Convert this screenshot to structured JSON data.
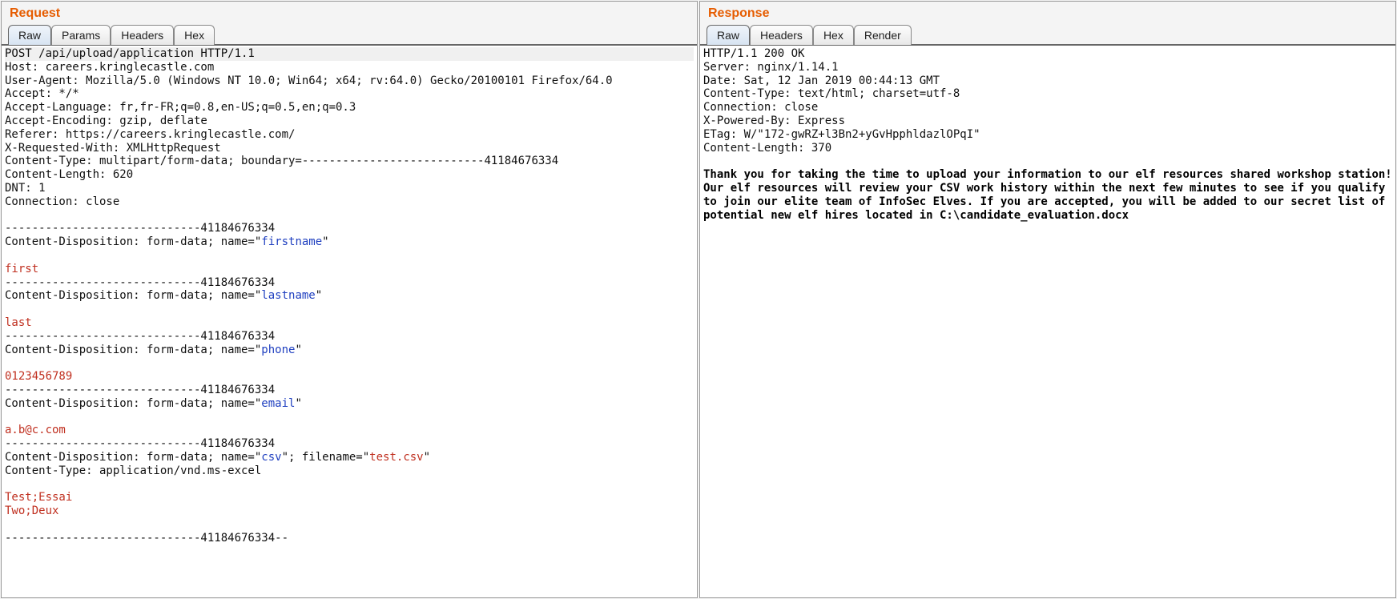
{
  "request": {
    "title": "Request",
    "tabs": [
      "Raw",
      "Params",
      "Headers",
      "Hex"
    ],
    "active_tab": 0,
    "first_line": "POST /api/upload/application HTTP/1.1",
    "headers": [
      "Host: careers.kringlecastle.com",
      "User-Agent: Mozilla/5.0 (Windows NT 10.0; Win64; x64; rv:64.0) Gecko/20100101 Firefox/64.0",
      "Accept: */*",
      "Accept-Language: fr,fr-FR;q=0.8,en-US;q=0.5,en;q=0.3",
      "Accept-Encoding: gzip, deflate",
      "Referer: https://careers.kringlecastle.com/",
      "X-Requested-With: XMLHttpRequest",
      "Content-Type: multipart/form-data; boundary=---------------------------41184676334",
      "Content-Length: 620",
      "DNT: 1",
      "Connection: close"
    ],
    "parts": [
      {
        "boundary": "-----------------------------41184676334",
        "disp_prefix": "Content-Disposition: form-data; name=\"",
        "name": "firstname",
        "disp_suffix": "\"",
        "value": "first"
      },
      {
        "boundary": "-----------------------------41184676334",
        "disp_prefix": "Content-Disposition: form-data; name=\"",
        "name": "lastname",
        "disp_suffix": "\"",
        "value": "last"
      },
      {
        "boundary": "-----------------------------41184676334",
        "disp_prefix": "Content-Disposition: form-data; name=\"",
        "name": "phone",
        "disp_suffix": "\"",
        "value": "0123456789"
      },
      {
        "boundary": "-----------------------------41184676334",
        "disp_prefix": "Content-Disposition: form-data; name=\"",
        "name": "email",
        "disp_suffix": "\"",
        "value": "a.b@c.com"
      }
    ],
    "file_part": {
      "boundary": "-----------------------------41184676334",
      "disp_prefix": "Content-Disposition: form-data; name=\"",
      "name": "csv",
      "mid": "\"; filename=\"",
      "filename": "test.csv",
      "suffix": "\"",
      "ctype": "Content-Type: application/vnd.ms-excel",
      "body1": "Test;Essai",
      "body2": "Two;Deux"
    },
    "closing_boundary": "-----------------------------41184676334--"
  },
  "response": {
    "title": "Response",
    "tabs": [
      "Raw",
      "Headers",
      "Hex",
      "Render"
    ],
    "active_tab": 0,
    "first_line": "HTTP/1.1 200 OK",
    "headers": [
      "Server: nginx/1.14.1",
      "Date: Sat, 12 Jan 2019 00:44:13 GMT",
      "Content-Type: text/html; charset=utf-8",
      "Connection: close",
      "X-Powered-By: Express",
      "ETag: W/\"172-gwRZ+l3Bn2+yGvHpphldazlOPqI\"",
      "Content-Length: 370"
    ],
    "body": "Thank you for taking the time to upload your information to our elf resources shared workshop station! Our elf resources will review your CSV work history within the next few minutes to see if you qualify to join our elite team of InfoSec Elves. If you are accepted, you will be added to our secret list of potential new elf hires located in C:\\candidate_evaluation.docx"
  }
}
